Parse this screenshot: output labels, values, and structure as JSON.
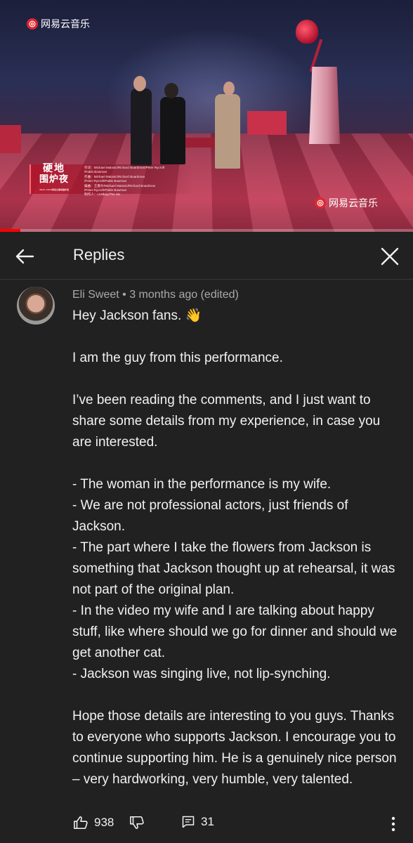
{
  "video": {
    "logo_text": "网易云音乐",
    "watermark_text": "网易云音乐",
    "show_title_line1": "硬地",
    "show_title_line2": "围炉夜",
    "show_title_sub": "2023-2024网易云硬地围炉夜",
    "credits": [
      "作词：Michael Matosic/Richard Boardman/Peter Rycroft",
      "/Pablo Bowman",
      "作曲：Michael Matosic/Richard Boardman",
      "/Peter Rycroft/Pablo Bowman",
      "编曲：王嘉尔/Michael Matosic/Richard Boardman",
      "/Peter Rycroft/Pablo Bowman",
      "制作人：Lostboy/The Six"
    ],
    "progress_fraction": 0.05,
    "accent_color": "#ff0000"
  },
  "header": {
    "title": "Replies",
    "back_icon": "arrow-left-icon",
    "close_icon": "close-icon"
  },
  "comment": {
    "meta": "Eli Sweet • 3 months ago (edited)",
    "paragraphs": [
      "Hey Jackson fans. 👋",
      "",
      "I am the guy from this performance.",
      "",
      "I’ve been reading the comments, and I just want to share some details from my experience, in case you are interested.",
      "",
      "- The woman in the performance is my wife.",
      "- We are not professional actors, just friends of Jackson.",
      "- The part where I take the flowers from Jackson is something that Jackson thought up at rehearsal, it was not part of the original plan.",
      "- In the video my wife and I are talking about happy stuff, like where should we go for dinner and should we get another cat.",
      "- Jackson was singing live, not lip-synching.",
      "",
      "Hope those details are interesting to you guys. Thanks to everyone who supports Jackson. I encourage you to continue supporting him. He is a genuinely nice person – very hardworking, very humble, very talented."
    ],
    "like_count": "938",
    "reply_count": "31"
  }
}
